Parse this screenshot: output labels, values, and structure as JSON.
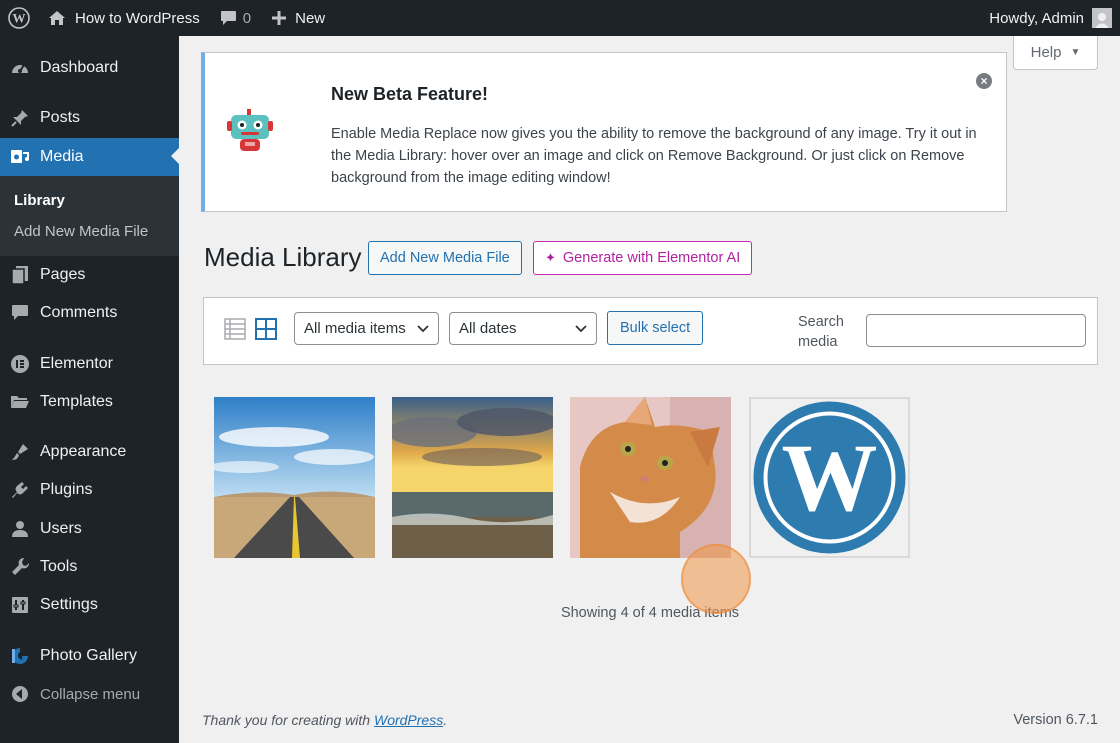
{
  "adminbar": {
    "site_name": "How to WordPress",
    "comments_count": "0",
    "new_label": "New",
    "greeting": "Howdy, Admin"
  },
  "sidebar": {
    "items": [
      {
        "label": "Dashboard",
        "icon": "dashboard-icon"
      },
      {
        "label": "Posts",
        "icon": "pin-icon"
      },
      {
        "label": "Media",
        "icon": "media-icon"
      },
      {
        "label": "Pages",
        "icon": "pages-icon"
      },
      {
        "label": "Comments",
        "icon": "comments-icon"
      },
      {
        "label": "Elementor",
        "icon": "elementor-icon"
      },
      {
        "label": "Templates",
        "icon": "folder-icon"
      },
      {
        "label": "Appearance",
        "icon": "brush-icon"
      },
      {
        "label": "Plugins",
        "icon": "plugin-icon"
      },
      {
        "label": "Users",
        "icon": "user-icon"
      },
      {
        "label": "Tools",
        "icon": "wrench-icon"
      },
      {
        "label": "Settings",
        "icon": "settings-icon"
      },
      {
        "label": "Photo Gallery",
        "icon": "photo-gallery-icon"
      }
    ],
    "submenu": [
      "Library",
      "Add New Media File"
    ],
    "collapse_label": "Collapse menu"
  },
  "help_label": "Help",
  "notice": {
    "title": "New Beta Feature!",
    "text": "Enable Media Replace now gives you the ability to remove the background of any image. Try it out in the Media Library: hover over an image and click on Remove Background. Or just click on Remove background from the image editing window!"
  },
  "page": {
    "title": "Media Library",
    "add_new_label": "Add New Media File",
    "ai_label": "Generate with Elementor AI"
  },
  "toolbar": {
    "type_filter": "All media items",
    "date_filter": "All dates",
    "bulk_select": "Bulk select",
    "search_label": "Search media"
  },
  "attachments": [
    {
      "name": "road-desert-image"
    },
    {
      "name": "sunset-sea-image"
    },
    {
      "name": "cat-image"
    },
    {
      "name": "wordpress-logo-image"
    }
  ],
  "showing_text": "Showing 4 of 4 media items",
  "footer": {
    "thanks_prefix": "Thank you for creating with",
    "thanks_link": "WordPress",
    "thanks_suffix": ".",
    "version": "Version 6.7.1"
  },
  "colors": {
    "admin_dark": "#1d2327",
    "accent_blue": "#2271b1",
    "ai_magenta": "#c42ab1",
    "notice_border": "#72aee6"
  }
}
